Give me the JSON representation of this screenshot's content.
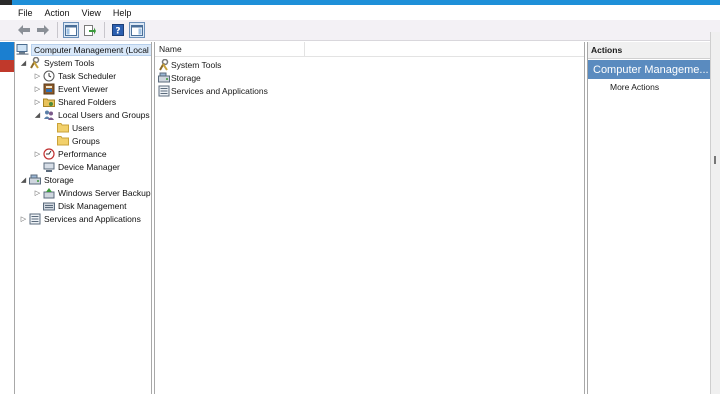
{
  "menu": [
    "File",
    "Action",
    "View",
    "Help"
  ],
  "toolbar": {
    "icons": [
      "back-arrow-icon",
      "forward-arrow-icon",
      "show-hide-tree-icon",
      "export-list-icon",
      "help-icon",
      "show-hide-action-pane-icon"
    ]
  },
  "tree": {
    "root": "Computer Management (Local",
    "system_tools": "System Tools",
    "task_scheduler": "Task Scheduler",
    "event_viewer": "Event Viewer",
    "shared_folders": "Shared Folders",
    "local_users_groups": "Local Users and Groups",
    "users": "Users",
    "groups": "Groups",
    "performance": "Performance",
    "device_manager": "Device Manager",
    "storage": "Storage",
    "windows_server_backup": "Windows Server Backup",
    "disk_management": "Disk Management",
    "services_apps": "Services and Applications"
  },
  "main": {
    "column_name": "Name",
    "rows": [
      "System Tools",
      "Storage",
      "Services and Applications"
    ]
  },
  "actions": {
    "header": "Actions",
    "section": "Computer Manageme...",
    "more": "More Actions"
  },
  "colors": {
    "accent": "#5a8bbf",
    "selection": "#d9e8f9",
    "window_strip": "#1e8fd8"
  }
}
